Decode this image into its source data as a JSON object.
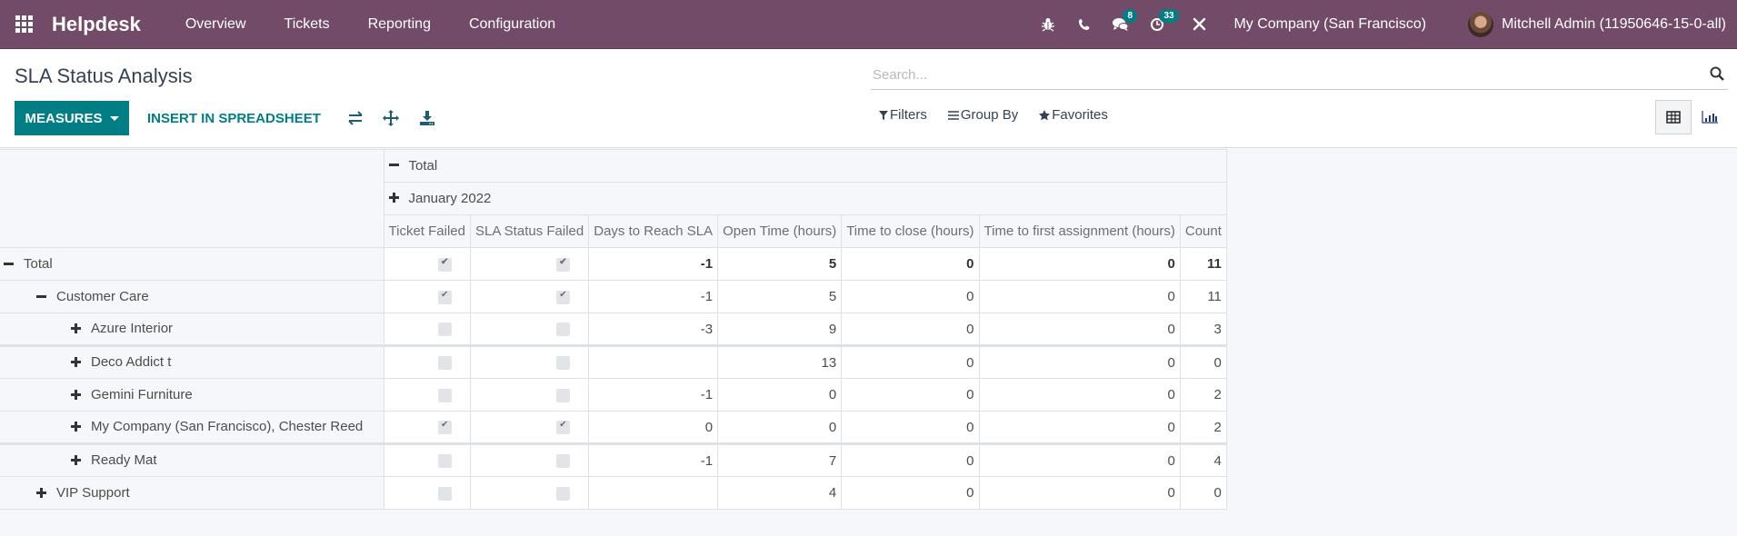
{
  "navbar": {
    "app_name": "Helpdesk",
    "menu": [
      "Overview",
      "Tickets",
      "Reporting",
      "Configuration"
    ],
    "icons": [
      "bug-icon",
      "phone-icon",
      "chat-icon",
      "activity-clock-icon",
      "tools-icon"
    ],
    "messages_badge": "8",
    "activities_badge": "33",
    "company": "My Company (San Francisco)",
    "user": "Mitchell Admin (11950646-15-0-all)"
  },
  "control_panel": {
    "title": "SLA Status Analysis",
    "search_placeholder": "Search...",
    "measures_label": "MEASURES",
    "insert_label": "INSERT IN SPREADSHEET",
    "tool_icons": [
      "flip-axis-icon",
      "expand-all-icon",
      "download-icon"
    ],
    "filters_label": "Filters",
    "groupby_label": "Group By",
    "favorites_label": "Favorites",
    "views": [
      {
        "name": "pivot",
        "active": true
      },
      {
        "name": "graph",
        "active": false
      }
    ]
  },
  "pivot": {
    "col_header_total": "Total",
    "col_header_group": "January 2022",
    "measures": [
      "Ticket Failed",
      "SLA Status Failed",
      "Days to Reach SLA",
      "Open Time (hours)",
      "Time to close (hours)",
      "Time to first assignment (hours)",
      "Count"
    ],
    "rows": [
      {
        "label": "Total",
        "level": 0,
        "expanded": true,
        "ticket_failed": true,
        "sla_failed": true,
        "days": "-1",
        "open": "5",
        "close": "0",
        "first": "0",
        "count": "11"
      },
      {
        "label": "Customer Care",
        "level": 1,
        "expanded": true,
        "ticket_failed": true,
        "sla_failed": true,
        "days": "-1",
        "open": "5",
        "close": "0",
        "first": "0",
        "count": "11"
      },
      {
        "label": "Azure Interior",
        "level": 2,
        "expanded": false,
        "ticket_failed": false,
        "sla_failed": false,
        "days": "-3",
        "open": "9",
        "close": "0",
        "first": "0",
        "count": "3"
      },
      {
        "label": "Deco Addict t",
        "level": 2,
        "expanded": false,
        "ticket_failed": false,
        "sla_failed": false,
        "days": "",
        "open": "13",
        "close": "0",
        "first": "0",
        "count": "0"
      },
      {
        "label": "Gemini Furniture",
        "level": 2,
        "expanded": false,
        "ticket_failed": false,
        "sla_failed": false,
        "days": "-1",
        "open": "0",
        "close": "0",
        "first": "0",
        "count": "2"
      },
      {
        "label": "My Company (San Francisco), Chester Reed",
        "level": 2,
        "expanded": false,
        "ticket_failed": true,
        "sla_failed": true,
        "days": "0",
        "open": "0",
        "close": "0",
        "first": "0",
        "count": "2"
      },
      {
        "label": "Ready Mat",
        "level": 2,
        "expanded": false,
        "ticket_failed": false,
        "sla_failed": false,
        "days": "-1",
        "open": "7",
        "close": "0",
        "first": "0",
        "count": "4"
      },
      {
        "label": "VIP Support",
        "level": 1,
        "expanded": false,
        "ticket_failed": false,
        "sla_failed": false,
        "days": "",
        "open": "4",
        "close": "0",
        "first": "0",
        "count": "0"
      }
    ]
  },
  "colors": {
    "brand": "#714b67",
    "accent": "#017e84"
  }
}
